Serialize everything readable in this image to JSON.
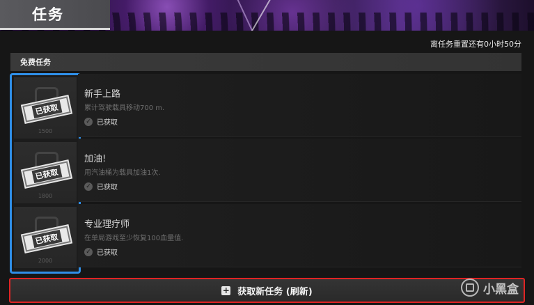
{
  "header": {
    "title": "任务"
  },
  "reset_notice": "离任务重置还有0小时50分",
  "section": {
    "title": "免费任务"
  },
  "tasks": [
    {
      "name": "新手上路",
      "desc": "累计驾驶载具移动700 m.",
      "status": "已获取",
      "reward_label": "已获取",
      "reward_amount": "1500"
    },
    {
      "name": "加油!",
      "desc": "用汽油桶为载具加油1次.",
      "status": "已获取",
      "reward_label": "已获取",
      "reward_amount": "1800"
    },
    {
      "name": "专业理疗师",
      "desc": "在单局游戏至少恢复100血量值.",
      "status": "已获取",
      "reward_label": "已获取",
      "reward_amount": "2000"
    }
  ],
  "refresh_button": {
    "label": "获取新任务 (刷新)"
  },
  "watermark": {
    "text": "小黑盒"
  },
  "colors": {
    "selection_border": "#2f8fe8",
    "refresh_border": "#e02424"
  }
}
